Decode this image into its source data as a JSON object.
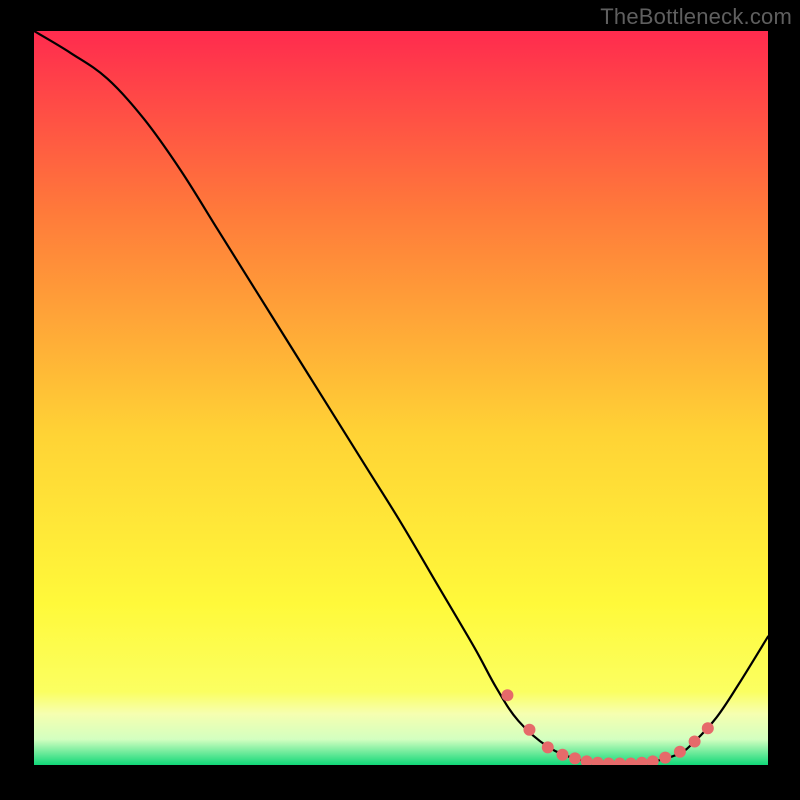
{
  "watermark": "TheBottleneck.com",
  "chart_data": {
    "type": "line",
    "title": "",
    "xlabel": "",
    "ylabel": "",
    "xlim": [
      0,
      100
    ],
    "ylim": [
      0,
      100
    ],
    "grid": false,
    "background_gradient": {
      "top": "#ff2b4e",
      "mid_upper": "#ff7b3a",
      "mid": "#ffd335",
      "mid_lower": "#fff93a",
      "band": "#f6ffb0",
      "bottom": "#10d878"
    },
    "series": [
      {
        "name": "bottleneck-curve",
        "x": [
          0,
          5,
          10,
          15,
          20,
          25,
          30,
          35,
          40,
          45,
          50,
          55,
          60,
          63,
          66,
          70,
          74,
          78,
          82,
          85,
          88,
          90,
          93,
          96,
          100
        ],
        "y": [
          100,
          97,
          93.5,
          88,
          81,
          73,
          65,
          57,
          49,
          41,
          33,
          24.5,
          16,
          10.5,
          6,
          2.5,
          0.8,
          0.2,
          0.2,
          0.6,
          1.6,
          3.2,
          6.5,
          11,
          17.5
        ]
      }
    ],
    "markers": {
      "name": "highlight-dots",
      "color": "#e66a6a",
      "points": [
        {
          "x": 64.5,
          "y": 9.5
        },
        {
          "x": 67.5,
          "y": 4.8
        },
        {
          "x": 70.0,
          "y": 2.4
        },
        {
          "x": 72.0,
          "y": 1.4
        },
        {
          "x": 73.7,
          "y": 0.9
        },
        {
          "x": 75.3,
          "y": 0.5
        },
        {
          "x": 76.8,
          "y": 0.3
        },
        {
          "x": 78.3,
          "y": 0.2
        },
        {
          "x": 79.8,
          "y": 0.2
        },
        {
          "x": 81.3,
          "y": 0.2
        },
        {
          "x": 82.8,
          "y": 0.3
        },
        {
          "x": 84.3,
          "y": 0.5
        },
        {
          "x": 86.0,
          "y": 1.0
        },
        {
          "x": 88.0,
          "y": 1.8
        },
        {
          "x": 90.0,
          "y": 3.2
        },
        {
          "x": 91.8,
          "y": 5.0
        }
      ]
    }
  }
}
